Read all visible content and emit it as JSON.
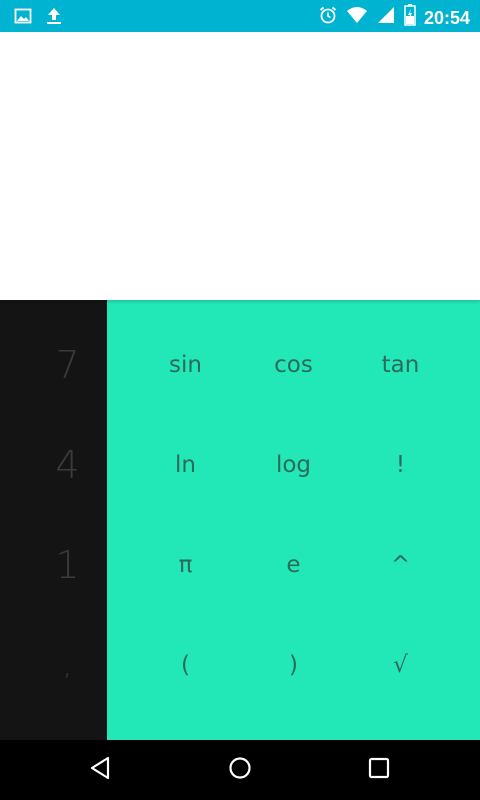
{
  "status_bar": {
    "time": "20:54",
    "left_icons": [
      "image-icon",
      "upload-icon"
    ],
    "right_icons": [
      "alarm-icon",
      "wifi-icon",
      "signal-icon",
      "battery-icon"
    ],
    "color": "#00b3d0"
  },
  "numpad": {
    "keys": [
      "7",
      "4",
      "1",
      ","
    ]
  },
  "advanced": {
    "color": "#22e8b8",
    "keys": [
      [
        "sin",
        "cos",
        "tan"
      ],
      [
        "ln",
        "log",
        "!"
      ],
      [
        "π",
        "e",
        "^"
      ],
      [
        "(",
        ")",
        "√"
      ]
    ]
  },
  "nav_bar": {
    "icons": [
      "back-icon",
      "home-icon",
      "recents-icon"
    ]
  }
}
